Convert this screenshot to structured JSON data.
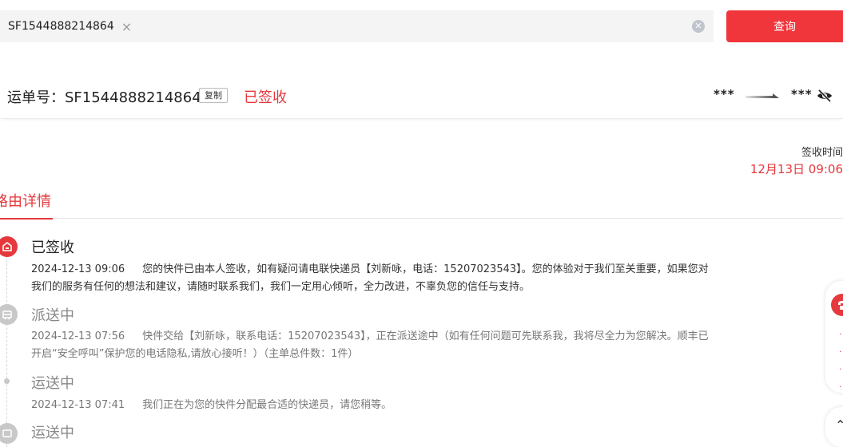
{
  "search": {
    "tag": "SF1544888214864",
    "placeholder": "",
    "query_label": "查询"
  },
  "waybill": {
    "label": "运单号：SF1544888214864",
    "copy_label": "复制",
    "status": "已签收",
    "route_from": "***",
    "route_to": "***"
  },
  "signed": {
    "label": "签收时间",
    "value": "12月13日 09:06"
  },
  "tabs": [
    {
      "label": "路由详情",
      "active": true
    }
  ],
  "timeline": [
    {
      "title": "已签收",
      "time": "2024-12-13 09:06",
      "desc": "您的快件已由本人签收，如有疑问请电联快递员【刘新咏，电话：15207023543】。您的体验对于我们至关重要，如果您对我们的服务有任何的想法和建议，请随时联系我们，我们一定用心倾听，全力改进，不辜负您的信任与支持。",
      "icon": "home-icon",
      "state": "active"
    },
    {
      "title": "派送中",
      "time": "2024-12-13 07:56",
      "desc": "快件交给【刘新咏，联系电话：15207023543】，正在派送途中（如有任何问题可先联系我，我将尽全力为您解决。顺丰已开启“安全呼叫”保护您的电话隐私,请放心接听！）（主单总件数：1件）",
      "icon": "delivery-truck-icon",
      "state": "gray"
    },
    {
      "title": "运送中",
      "time": "2024-12-13 07:41",
      "desc": "我们正在为您的快件分配最合适的快递员，请您稍等。",
      "icon": "dot",
      "state": "gray"
    },
    {
      "title": "运送中",
      "icon": "transport-icon",
      "state": "gray"
    }
  ],
  "colors": {
    "accent": "#e5393d",
    "button": "#f0353b",
    "muted": "#c8c8c8"
  }
}
